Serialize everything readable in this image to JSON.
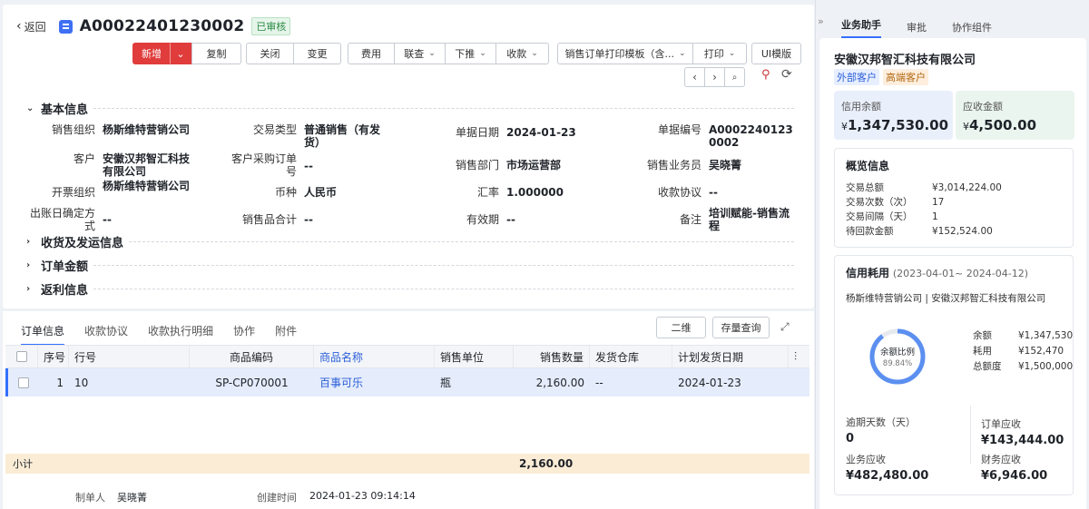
{
  "header": {
    "back_label": "返回",
    "doc_number": "A00022401230002",
    "status": "已审核"
  },
  "toolbar": {
    "new": "新增",
    "copy": "复制",
    "close": "关闭",
    "change": "变更",
    "expense": "费用",
    "link_query": "联查",
    "push_down": "下推",
    "collect": "收款",
    "print_template": "销售订单打印模板（含...",
    "print": "打印",
    "ui_template": "UI模版"
  },
  "sections": {
    "basic": "基本信息",
    "shipping": "收货及发运信息",
    "amount": "订单金额",
    "rebate": "返利信息"
  },
  "fields": {
    "sales_org": {
      "label": "销售组织",
      "value": "杨斯维特营销公司"
    },
    "trade_type": {
      "label": "交易类型",
      "value": "普通销售（有发货）"
    },
    "doc_date": {
      "label": "单据日期",
      "value": "2024-01-23"
    },
    "doc_no": {
      "label": "单据编号",
      "value": "A00022401230002"
    },
    "customer": {
      "label": "客户",
      "value": "安徽汉邦智汇科技有限公司"
    },
    "cust_po": {
      "label": "客户采购订单号",
      "value": "--"
    },
    "sales_dept": {
      "label": "销售部门",
      "value": "市场运营部"
    },
    "salesperson": {
      "label": "销售业务员",
      "value": "吴晓菁"
    },
    "invoice_org": {
      "label": "开票组织",
      "value": "杨斯维特营销公司"
    },
    "currency": {
      "label": "币种",
      "value": "人民币"
    },
    "rate": {
      "label": "汇率",
      "value": "1.000000"
    },
    "collection": {
      "label": "收款协议",
      "value": "--"
    },
    "billing_method": {
      "label": "出账日确定方式",
      "value": "--"
    },
    "sales_total": {
      "label": "销售品合计",
      "value": "--"
    },
    "validity": {
      "label": "有效期",
      "value": "--"
    },
    "remark": {
      "label": "备注",
      "value": "培训赋能-销售流程"
    }
  },
  "detail_tabs": [
    "订单信息",
    "收款协议",
    "收款执行明细",
    "协作",
    "附件"
  ],
  "detail_actions": {
    "qrcode": "二维",
    "stock_query": "存量查询"
  },
  "table": {
    "columns": [
      "序号",
      "行号",
      "商品编码",
      "商品名称",
      "销售单位",
      "销售数量",
      "发货仓库",
      "计划发货日期"
    ],
    "rows": [
      {
        "seq": "1",
        "line": "10",
        "code": "SP-CP070001",
        "name": "百事可乐",
        "unit": "瓶",
        "qty": "2,160.00",
        "warehouse": "--",
        "ship_date": "2024-01-23"
      }
    ],
    "subtotal_label": "小计",
    "subtotal_qty": "2,160.00"
  },
  "footer": {
    "creator_label": "制单人",
    "creator": "吴晓菁",
    "created_label": "创建时间",
    "created": "2024-01-23 09:14:14"
  },
  "side": {
    "tabs": [
      "业务助手",
      "审批",
      "协作组件"
    ],
    "company": "安徽汉邦智汇科技有限公司",
    "tags": [
      "外部客户",
      "高端客户"
    ],
    "credit_balance": {
      "label": "信用余额",
      "currency": "¥",
      "value": "1,347,530.00"
    },
    "receivable": {
      "label": "应收金额",
      "currency": "¥",
      "value": "4,500.00"
    },
    "overview": {
      "title": "概览信息",
      "items": [
        {
          "k": "交易总额",
          "v": "¥3,014,224.00"
        },
        {
          "k": "交易次数（次）",
          "v": "17"
        },
        {
          "k": "交易间隔（天）",
          "v": "1"
        },
        {
          "k": "待回款金额",
          "v": "¥152,524.00"
        }
      ]
    },
    "credit_use": {
      "title": "信用耗用",
      "period": "(2023-04-01~ 2024-04-12)",
      "parties": "杨斯维特营销公司 | 安徽汉邦智汇科技有限公司",
      "donut_label": "余额比例",
      "donut_pct": "89.84%",
      "donut_ratio": 0.8984,
      "legend": [
        {
          "k": "余额",
          "v": "¥1,347,530"
        },
        {
          "k": "耗用",
          "v": "¥152,470"
        },
        {
          "k": "总额度",
          "v": "¥1,500,000"
        }
      ],
      "overdue_days": {
        "label": "逾期天数（天）",
        "value": "0"
      },
      "order_ar": {
        "label": "订单应收",
        "value": "¥143,444.00"
      },
      "biz_ar": {
        "label": "业务应收",
        "value": "¥482,480.00"
      },
      "fin_ar": {
        "label": "财务应收",
        "value": "¥6,946.00"
      }
    }
  },
  "colors": {
    "accent": "#3370ff",
    "danger": "#e03c3c",
    "approved": "#2a8a44"
  }
}
